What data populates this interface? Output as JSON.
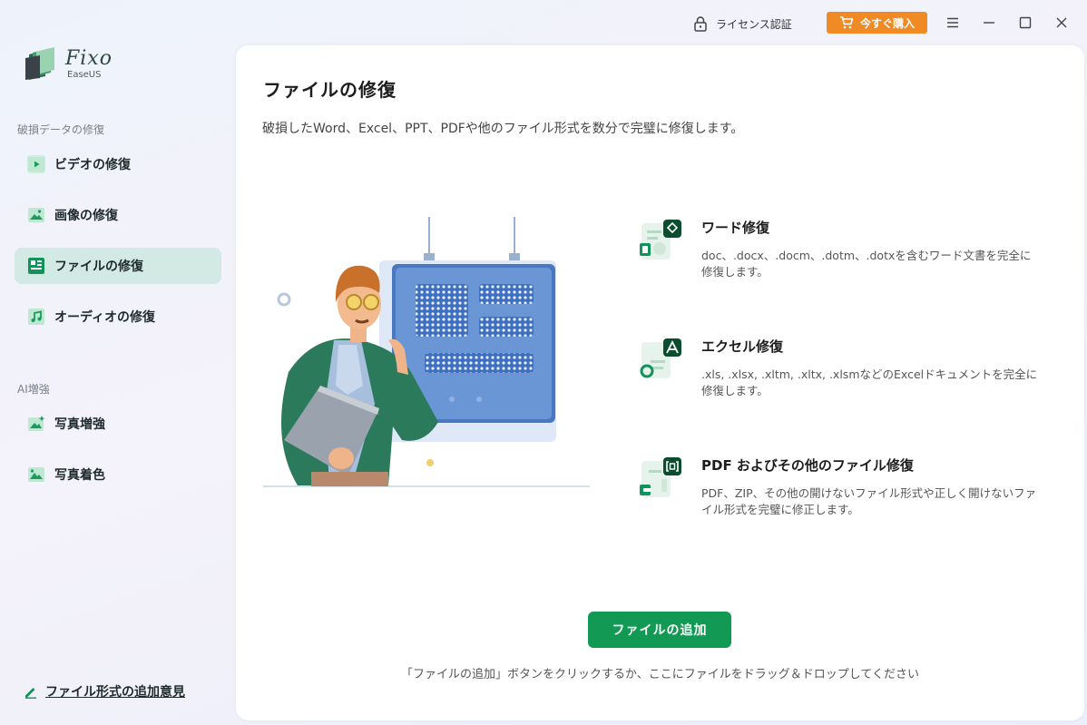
{
  "titlebar": {
    "license_label": "ライセンス認証",
    "buy_label": "今すぐ購入",
    "buy_color": "#f08a24"
  },
  "logo": {
    "name": "Fixo",
    "sub": "EaseUS"
  },
  "sidebar": {
    "section1_title": "破損データの修復",
    "items": [
      {
        "label": "ビデオの修復",
        "icon": "video-icon"
      },
      {
        "label": "画像の修復",
        "icon": "image-icon"
      },
      {
        "label": "ファイルの修復",
        "icon": "file-icon"
      },
      {
        "label": "オーディオの修復",
        "icon": "audio-icon"
      }
    ],
    "section2_title": "AI増強",
    "ai_items": [
      {
        "label": "写真増強",
        "icon": "photo-enhance-icon"
      },
      {
        "label": "写真着色",
        "icon": "photo-colorize-icon"
      }
    ],
    "feedback_label": "ファイル形式の追加意見",
    "active_bg": "#d3e9e4"
  },
  "main": {
    "title": "ファイルの修復",
    "description": "破損したWord、Excel、PPT、PDFや他のファイル形式を数分で完璧に修復します。",
    "features": [
      {
        "title": "ワード修復",
        "desc": "doc、.docx、.docm、.dotm、.dotxを含むワード文書を完全に修復します。",
        "icon": "word-repair-icon"
      },
      {
        "title": "エクセル修復",
        "desc": ".xls, .xlsx, .xltm, .xltx, .xlsmなどのExcelドキュメントを完全に修復します。",
        "icon": "excel-repair-icon"
      },
      {
        "title": "PDF およびその他のファイル修復",
        "desc": "PDF、ZIP、その他の開けないファイル形式や正しく開けないファイル形式を完璧に修正します。",
        "icon": "pdf-repair-icon"
      }
    ],
    "add_button_label": "ファイルの追加",
    "hint": "「ファイルの追加」ボタンをクリックするか、ここにファイルをドラッグ＆ドロップしてください",
    "accent": "#129a55"
  }
}
